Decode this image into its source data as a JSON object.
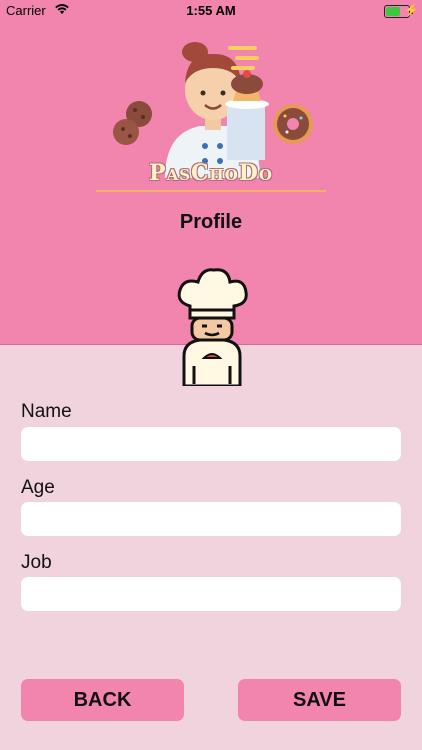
{
  "status_bar": {
    "carrier": "Carrier",
    "time": "1:55 AM",
    "battery_color": "#3ec83e"
  },
  "header": {
    "brand": "PasChoDo",
    "title": "Profile",
    "background": "#f285ad"
  },
  "images": {
    "hero": "chef-woman-with-cupcake-illustration",
    "avatar": "chef-hat-avatar-icon"
  },
  "form": {
    "fields": [
      {
        "label": "Name",
        "value": "",
        "placeholder": ""
      },
      {
        "label": "Age",
        "value": "",
        "placeholder": ""
      },
      {
        "label": "Job",
        "value": "",
        "placeholder": ""
      }
    ]
  },
  "buttons": {
    "back": "BACK",
    "save": "SAVE",
    "color": "#f285ad"
  },
  "colors": {
    "page_background": "#f0d3dd",
    "accent": "#f285ad"
  }
}
